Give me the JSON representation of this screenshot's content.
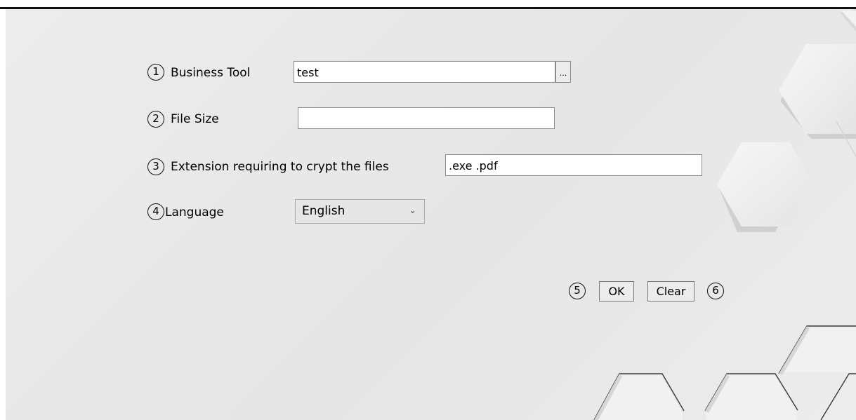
{
  "form": {
    "business_tool": {
      "number": "1",
      "label": "Business Tool",
      "value": "test",
      "browse_label": "..."
    },
    "file_size": {
      "number": "2",
      "label": "File Size",
      "value": ""
    },
    "extension": {
      "number": "3",
      "label": "Extension requiring to crypt the files",
      "value": ".exe .pdf"
    },
    "language": {
      "number": "4",
      "label": "Language",
      "selected": "English"
    }
  },
  "actions": {
    "ok": {
      "number": "5",
      "label": "OK"
    },
    "clear": {
      "number": "6",
      "label": "Clear"
    }
  },
  "colors": {
    "background": "#e9e9e9",
    "field_border": "#8c8c8c",
    "hexagon_face": "#f2f2f2",
    "hexagon_shadow": "#cfcfcf"
  }
}
